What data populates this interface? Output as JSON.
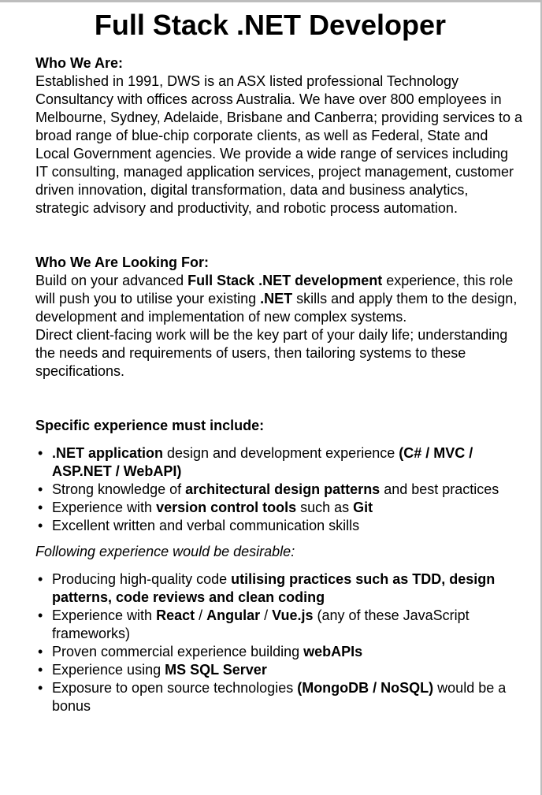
{
  "title": "Full Stack .NET Developer",
  "who_we_are": {
    "heading": "Who We Are:",
    "body": "Established in 1991, DWS is an ASX listed professional Technology Consultancy with offices across Australia. We have over 800 employees in Melbourne, Sydney, Adelaide, Brisbane and Canberra; providing services to a broad range of blue-chip corporate clients, as well as Federal, State and Local Government agencies. We provide a wide range of services including IT consulting, managed application services, project management, customer driven innovation, digital transformation, data and business analytics, strategic advisory and productivity, and robotic process automation."
  },
  "looking_for": {
    "heading": "Who We Are Looking For:",
    "p1_a": "Build on your advanced ",
    "p1_b": "Full Stack .NET development",
    "p1_c": " experience, this role will push you to utilise your existing ",
    "p1_d": ".NET",
    "p1_e": " skills and apply them to the design, development and implementation of new complex systems.",
    "p2": "Direct client-facing work will be the key part of your daily life; understanding the needs and requirements of users, then tailoring systems to these specifications."
  },
  "specific": {
    "heading": "Specific experience must include:",
    "items": [
      {
        "a": ".NET application",
        "b": " design and development experience ",
        "c": "(C# / MVC / ASP.NET / WebAPI)"
      },
      {
        "a": "Strong knowledge of ",
        "b": "architectural design patterns",
        "c": " and best practices"
      },
      {
        "a": "Experience with ",
        "b": "version control tools",
        "c": " such as ",
        "d": "Git"
      },
      {
        "a": "Excellent written and verbal communication skills"
      }
    ]
  },
  "desirable": {
    "heading": "Following experience would be desirable:",
    "items": [
      {
        "a": "Producing high-quality code ",
        "b": "utilising practices such as TDD, design patterns, code reviews and clean coding"
      },
      {
        "a": "Experience with ",
        "b": "React",
        "c": " / ",
        "d": "Angular",
        "e": " / ",
        "f": "Vue.js",
        "g": " (any of these JavaScript frameworks)"
      },
      {
        "a": "Proven commercial experience building ",
        "b": "webAPIs"
      },
      {
        "a": "Experience using ",
        "b": "MS SQL Server"
      },
      {
        "a": "Exposure to open source technologies ",
        "b": "(MongoDB / NoSQL)",
        "c": " would be a bonus"
      }
    ]
  }
}
